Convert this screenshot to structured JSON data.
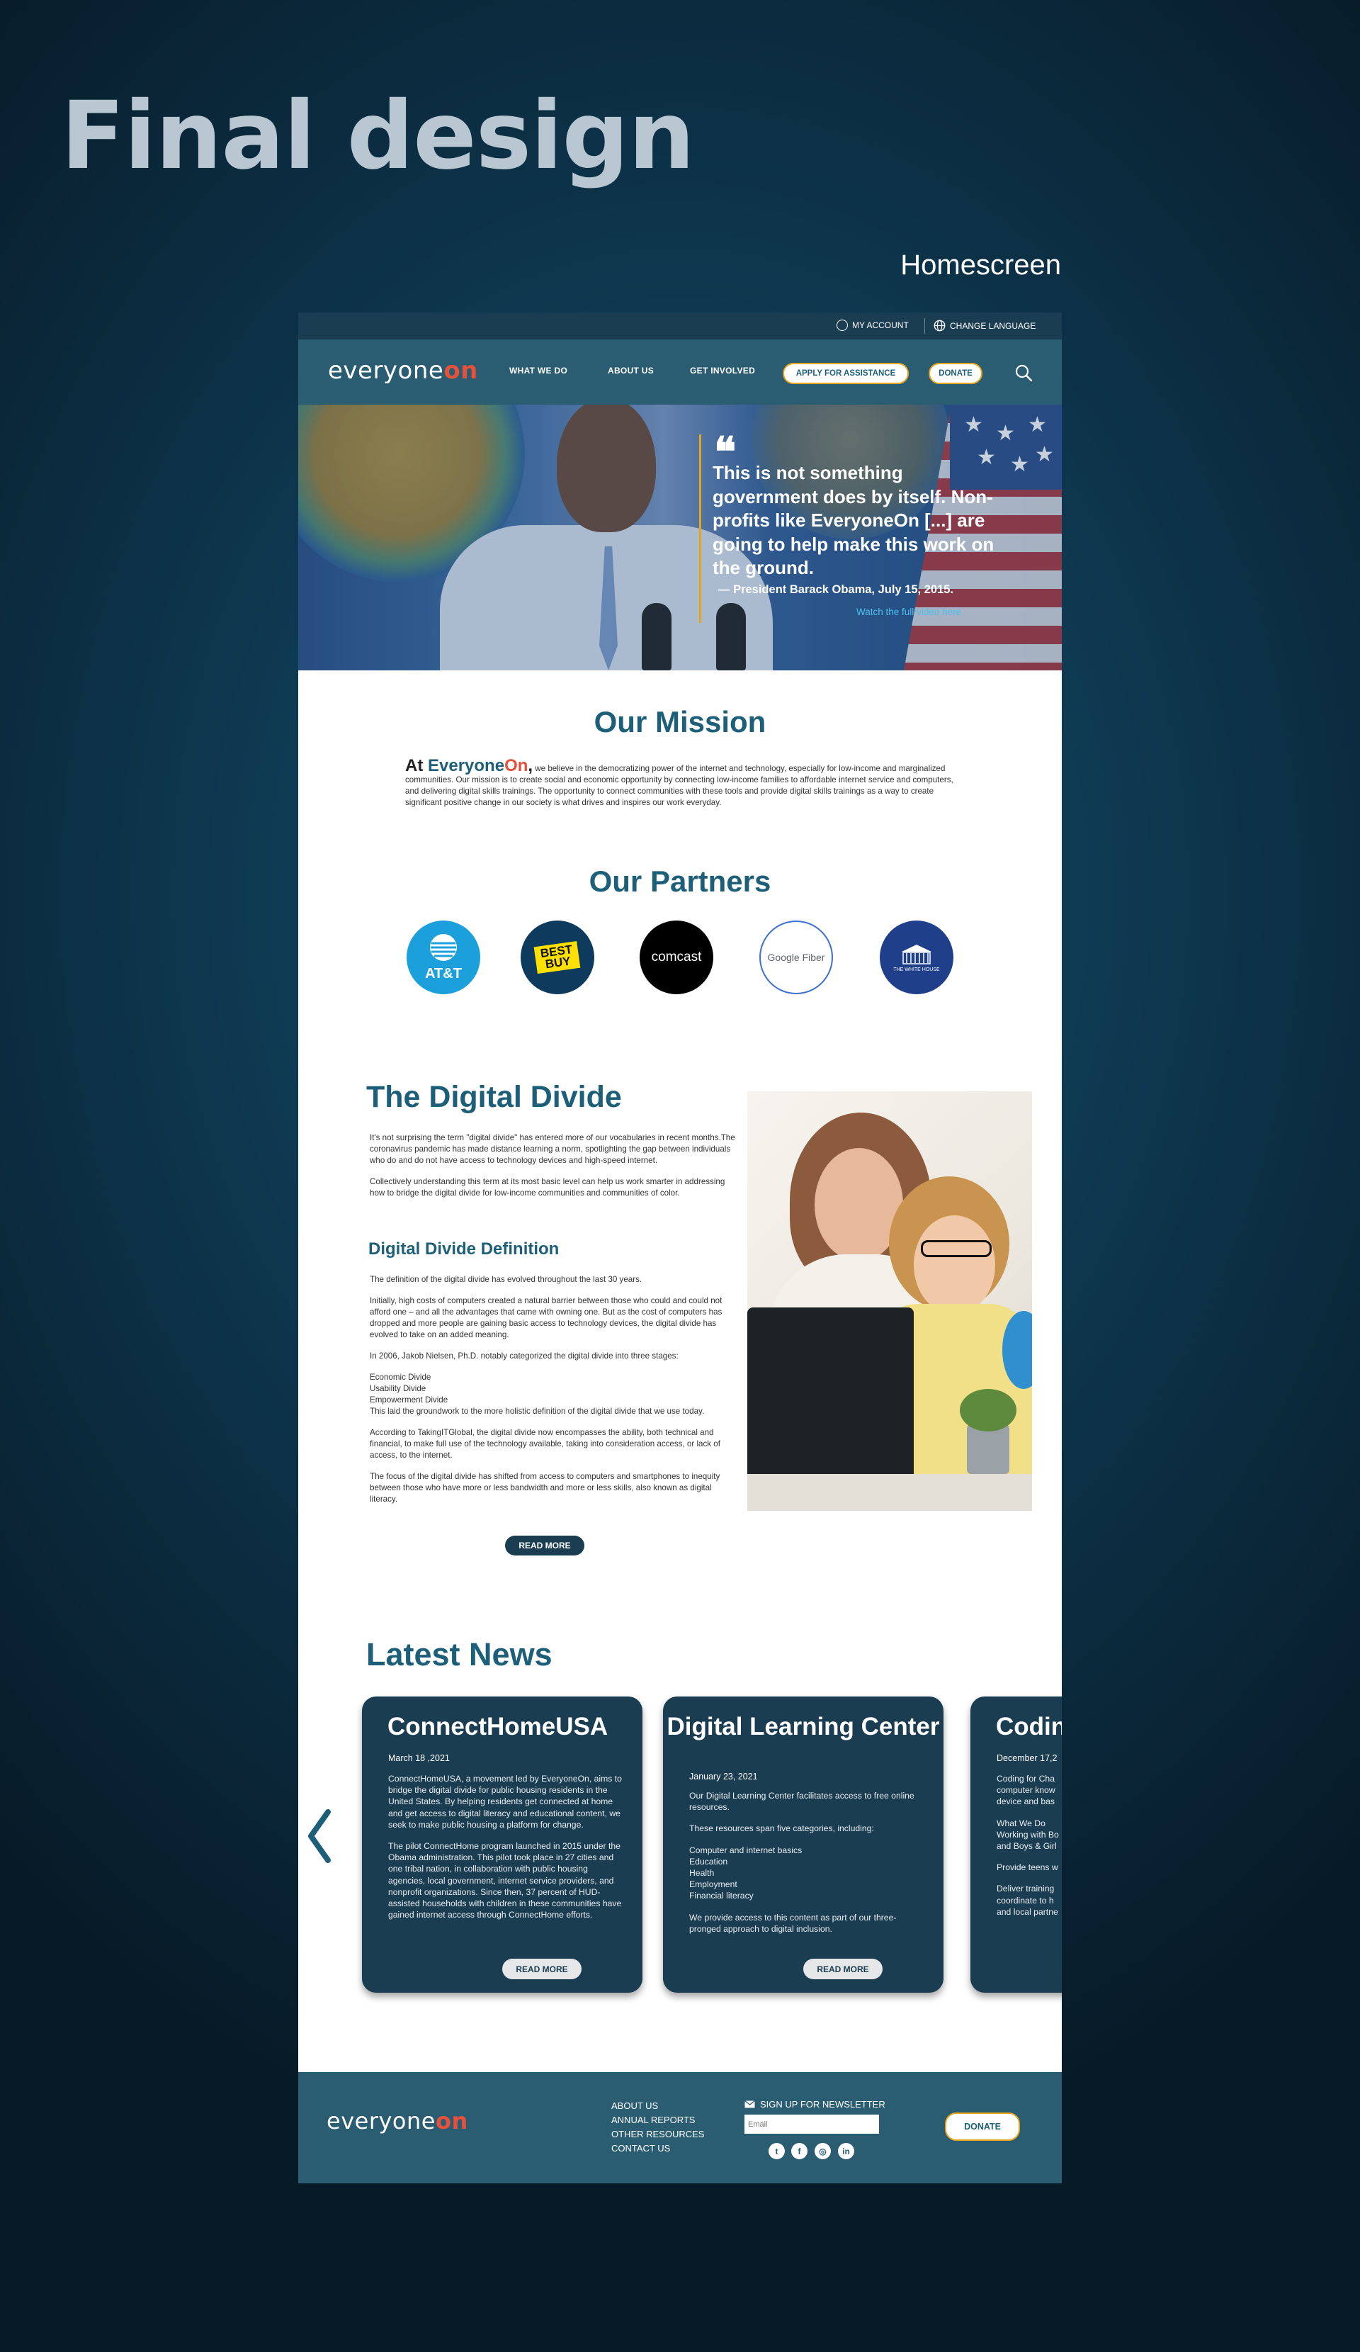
{
  "presentation": {
    "title": "Final design",
    "screen_label": "Homescreen"
  },
  "utility_bar": {
    "my_account": "MY ACCOUNT",
    "change_language": "CHANGE LANGUAGE"
  },
  "brand": {
    "logo_main": "everyone",
    "logo_accent": "on"
  },
  "nav": {
    "what_we_do": "WHAT WE DO",
    "about_us": "ABOUT US",
    "get_involved": "GET INVOLVED",
    "apply": "APPLY FOR ASSISTANCE",
    "donate": "DONATE"
  },
  "hero": {
    "quote_mark": "❝",
    "quote": "This is not something government does by itself. Non-profits like EveryoneOn [...] are going to help make this work on the ground.",
    "attribution": "— President Barack Obama, July 15, 2015.",
    "watch_link": "Watch the full video here"
  },
  "mission": {
    "title": "Our Mission",
    "lead_at": "At ",
    "lead_everyone": "Everyone",
    "lead_on": "On",
    "lead_comma": ",",
    "body": " we believe in the democratizing power of the internet and technology, especially for low-income and marginalized communities. Our mission is to create social and economic opportunity by connecting low-income families to affordable internet service and computers, and delivering digital skills trainings. The opportunity to connect communities with these tools and provide digital skills trainings as a way to create significant positive change in our society is what drives and inspires our work everyday."
  },
  "partners": {
    "title": "Our Partners",
    "att": "AT&T",
    "bestbuy_1": "BEST",
    "bestbuy_2": "BUY",
    "comcast": "comcast",
    "google_fiber": "Google Fiber",
    "white_house": "THE WHITE HOUSE"
  },
  "digital_divide": {
    "title": "The Digital Divide",
    "p1": "It's not surprising the term \"digital divide\" has entered more of our vocabularies in recent months.The coronavirus pandemic has made distance learning a norm, spotlighting the gap between individuals who do and do not have access to technology devices and high-speed internet.",
    "p2": "Collectively understanding this term at its most basic level can help us work smarter in addressing how to bridge the digital divide for low-income communities and communities of color.",
    "subtitle": "Digital Divide Definition",
    "d1": "The definition of the digital divide has evolved throughout the last 30 years.",
    "d2": "Initially, high costs of computers created a natural barrier between those who could and could not afford one – and all the advantages that came with owning one. But as the cost of computers has dropped and more people are gaining basic access to technology devices, the digital divide has evolved to take on an added meaning.",
    "d3": "In 2006, Jakob Nielsen, Ph.D. notably categorized the digital divide into three stages:",
    "d4_1": "Economic Divide",
    "d4_2": "Usability Divide",
    "d4_3": "Empowerment Divide",
    "d4_4": "This laid the groundwork to the more holistic definition of the digital divide that we use today.",
    "d5": "According to TakingITGlobal, the digital divide now encompasses the ability, both technical and financial, to make full use of the technology available, taking into consideration access, or lack of access, to the internet.",
    "d6": "The focus of the digital divide has shifted from access to computers and smartphones to inequity between those who have more or less bandwidth and more or less skills, also known as digital literacy.",
    "read_more": "READ MORE"
  },
  "news": {
    "title": "Latest News",
    "cards": [
      {
        "title": "ConnectHomeUSA",
        "date": "March 18 ,2021",
        "p1": "ConnectHomeUSA, a movement led by EveryoneOn, aims to bridge the digital divide for public housing residents in the United States. By helping residents get connected at home and get access to digital literacy and educational content, we seek to make public housing a platform for change.",
        "p2": "The pilot ConnectHome program launched in 2015 under the Obama administration. This pilot took place in 27 cities and one tribal nation, in collaboration with public housing agencies, local government, internet service providers, and nonprofit organizations. Since then, 37 percent of HUD-assisted households with children in these communities have gained internet access through ConnectHome efforts.",
        "read_more": "READ MORE"
      },
      {
        "title": "Digital Learning Center",
        "date": "January 23, 2021",
        "p1": "Our Digital Learning Center facilitates access to free online resources.",
        "p2": "These resources span five categories, including:",
        "list_1": "Computer and internet basics",
        "list_2": "Education",
        "list_3": "Health",
        "list_4": "Employment",
        "list_5": "Financial literacy",
        "p3": "We provide access to this content as part of our three-pronged approach to digital inclusion.",
        "read_more": "READ MORE"
      },
      {
        "title": "Codin",
        "date": "December 17,2",
        "p1": "Coding for Cha computer know device and bas",
        "p2": "What We Do Working with Bo and Boys & Girl",
        "p3": "Provide teens w",
        "p4": "Deliver training coordinate to h and local partne"
      }
    ]
  },
  "footer": {
    "about_us": "ABOUT US",
    "annual_reports": "ANNUAL REPORTS",
    "other_resources": "OTHER RESOURCES",
    "contact_us": "CONTACT US",
    "newsletter": "SIGN UP FOR NEWSLETTER",
    "email_placeholder": "Email",
    "donate": "DONATE"
  },
  "colors": {
    "brand_teal": "#1d5f78",
    "nav_bg": "#2a5c72",
    "dark_navy": "#1b3d52",
    "accent_orange": "#e5513a",
    "accent_gold": "#e6a51c"
  }
}
